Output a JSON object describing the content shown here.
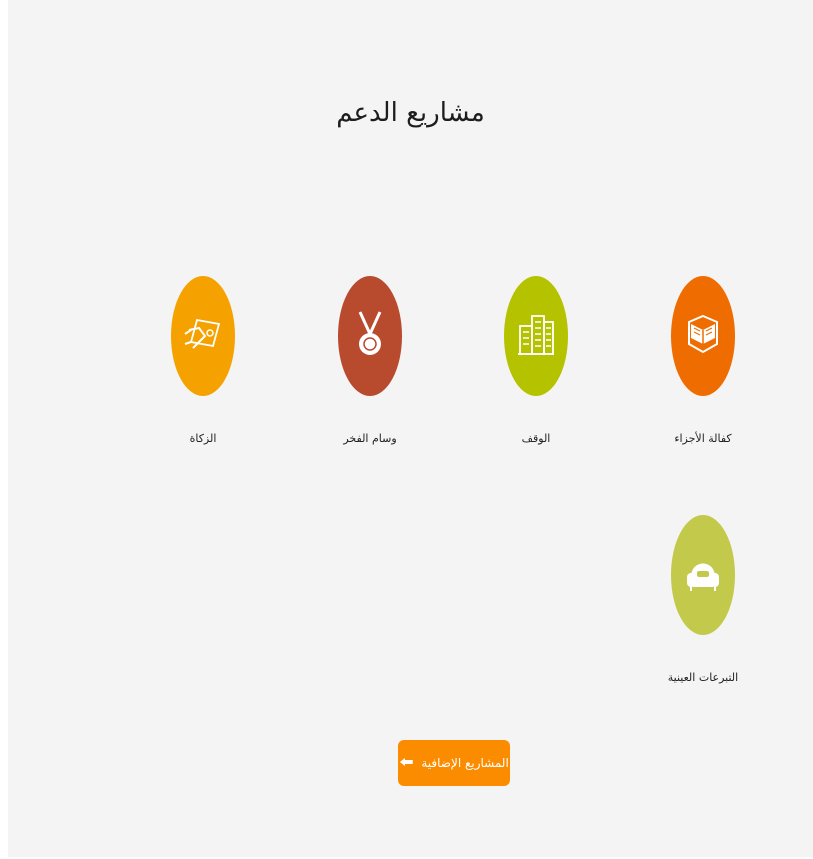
{
  "page_title": "مشاريع الدعم",
  "projects": [
    {
      "label": "كفالة الأجزاء",
      "color": "#ef6c00",
      "icon": "open-book-icon"
    },
    {
      "label": "الوقف",
      "color": "#b5c200",
      "icon": "buildings-icon"
    },
    {
      "label": "وسام الفخر",
      "color": "#b84a2e",
      "icon": "medal-icon"
    },
    {
      "label": "الزكاة",
      "color": "#f5a200",
      "icon": "hand-money-icon"
    },
    {
      "label": "التبرعات العينية",
      "color": "#c3c94a",
      "icon": "armchair-icon"
    }
  ],
  "more_button": {
    "label": "المشاريع الإضافية",
    "color": "#fb8c00",
    "icon": "arrow-left-icon"
  }
}
